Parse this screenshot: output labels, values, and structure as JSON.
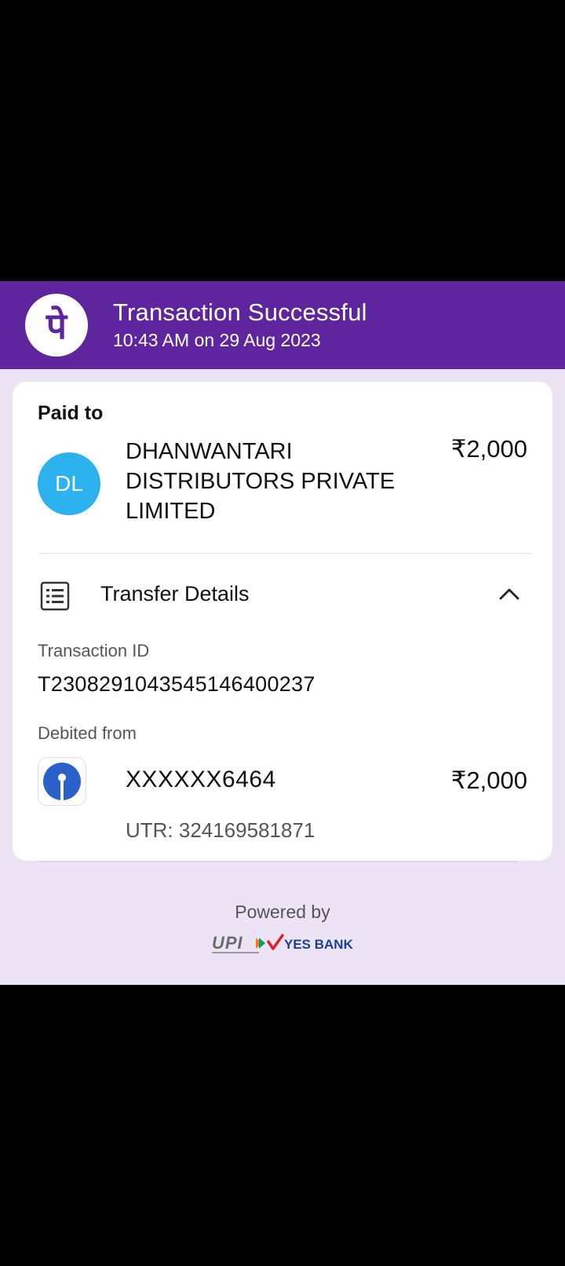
{
  "header": {
    "title": "Transaction Successful",
    "timestamp": "10:43 AM on 29 Aug 2023",
    "logo_glyph": "पे",
    "logo_color": "#5f259f",
    "background_color": "#5f259f"
  },
  "payee": {
    "label": "Paid to",
    "initials": "DL",
    "avatar_color": "#2bb2ef",
    "name": "DHANWANTARI DISTRIBUTORS PRIVATE LIMITED",
    "amount": "₹2,000"
  },
  "transfer_details": {
    "title": "Transfer Details",
    "icon": "receipt-list-icon",
    "toggle_icon": "chevron-up-icon",
    "transaction_id_label": "Transaction ID",
    "transaction_id": "T2308291043545146400237",
    "debited_from_label": "Debited from",
    "bank_icon": "sbi-bank-icon",
    "account_number": "XXXXXX6464",
    "amount": "₹2,000",
    "utr": "UTR: 324169581871"
  },
  "footer": {
    "powered_by": "Powered by",
    "partners": [
      "UPI",
      "YES BANK"
    ]
  }
}
